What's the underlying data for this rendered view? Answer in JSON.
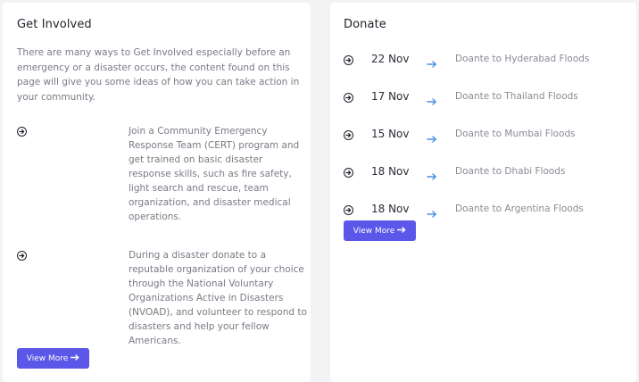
{
  "get_involved": {
    "title": "Get Involved",
    "intro": "There are many ways to Get Involved especially before an emergency or a disaster occurs, the content found on this page will give you some ideas of how you can take action in your community.",
    "items": [
      {
        "text": "Join a Community Emergency Response Team (CERT) program and get trained on basic disaster response skills, such as fire safety, light search and rescue, team organization, and disaster medical operations."
      },
      {
        "text": "During a disaster donate to a reputable organization of your choice through the National Voluntary Organizations Active in Disasters (NVOAD), and volunteer to respond to disasters and help your fellow Americans."
      }
    ],
    "button_label": "View More"
  },
  "donate": {
    "title": "Donate",
    "items": [
      {
        "date": "22 Nov",
        "text": "Doante to Hyderabad Floods"
      },
      {
        "date": "17 Nov",
        "text": "Doante to Thailand Floods"
      },
      {
        "date": "15 Nov",
        "text": "Doante to Mumbai Floods"
      },
      {
        "date": "18 Nov",
        "text": "Doante to Dhabi Floods"
      },
      {
        "date": "18 Nov",
        "text": "Doante to Argentina Floods"
      }
    ],
    "button_label": "View More"
  },
  "colors": {
    "accent": "#5b57e8",
    "link_arrow": "#4a90e2",
    "heading": "#1f1f2b",
    "muted_text": "#7a7a86"
  },
  "icons": {
    "bullet": "circle-arrow-right-icon",
    "row_arrow": "arrow-right-icon",
    "button_arrow": "long-arrow-right-icon"
  }
}
